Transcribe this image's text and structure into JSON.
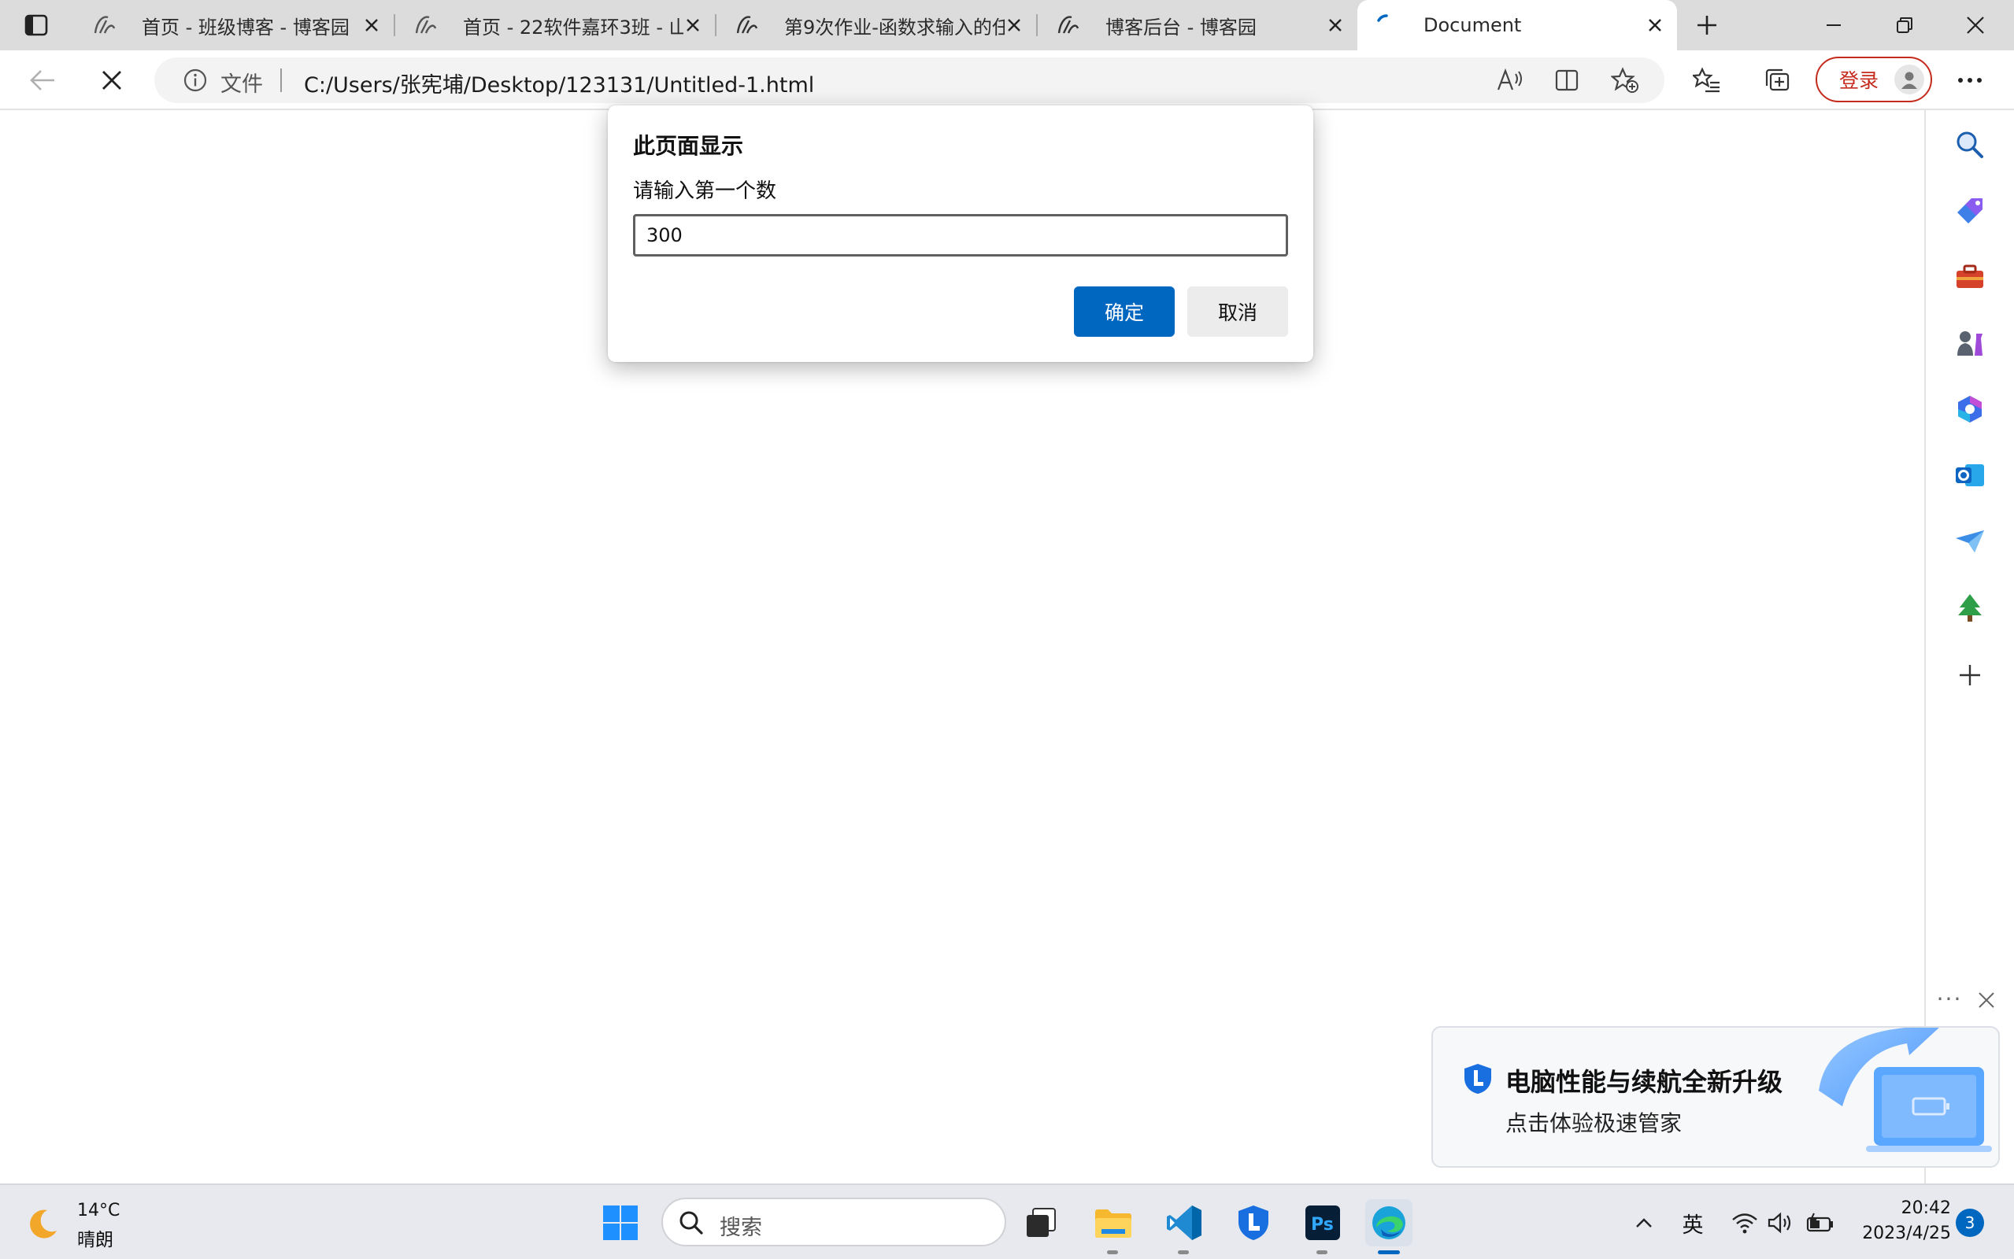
{
  "tabs": [
    {
      "title": "首页 - 班级博客 - 博客园",
      "icon": "cnblogs-icon"
    },
    {
      "title": "首页 - 22软件嘉环3班 - 山",
      "icon": "cnblogs-icon"
    },
    {
      "title": "第9次作业-函数求输入的任",
      "icon": "cnblogs-icon"
    },
    {
      "title": "博客后台 - 博客园",
      "icon": "cnblogs-icon"
    },
    {
      "title": "Document",
      "icon": "loading-spinner-icon",
      "active": true
    }
  ],
  "address": {
    "scheme_label": "文件",
    "url": "C:/Users/张宪埔/Desktop/123131/Untitled-1.html"
  },
  "toolbar": {
    "login_label": "登录"
  },
  "dialog": {
    "title": "此页面显示",
    "message": "请输入第一个数",
    "input_value": "300",
    "ok_label": "确定",
    "cancel_label": "取消"
  },
  "notification": {
    "title": "电脑性能与续航全新升级",
    "subtitle": "点击体验极速管家",
    "more_label": "···"
  },
  "taskbar": {
    "weather_temp": "14°C",
    "weather_cond": "晴朗",
    "search_placeholder": "搜索",
    "ime_label": "英",
    "time": "20:42",
    "date": "2023/4/25",
    "notification_count": "3"
  },
  "colors": {
    "accent": "#0067c0",
    "login_red": "#c42b1c"
  }
}
